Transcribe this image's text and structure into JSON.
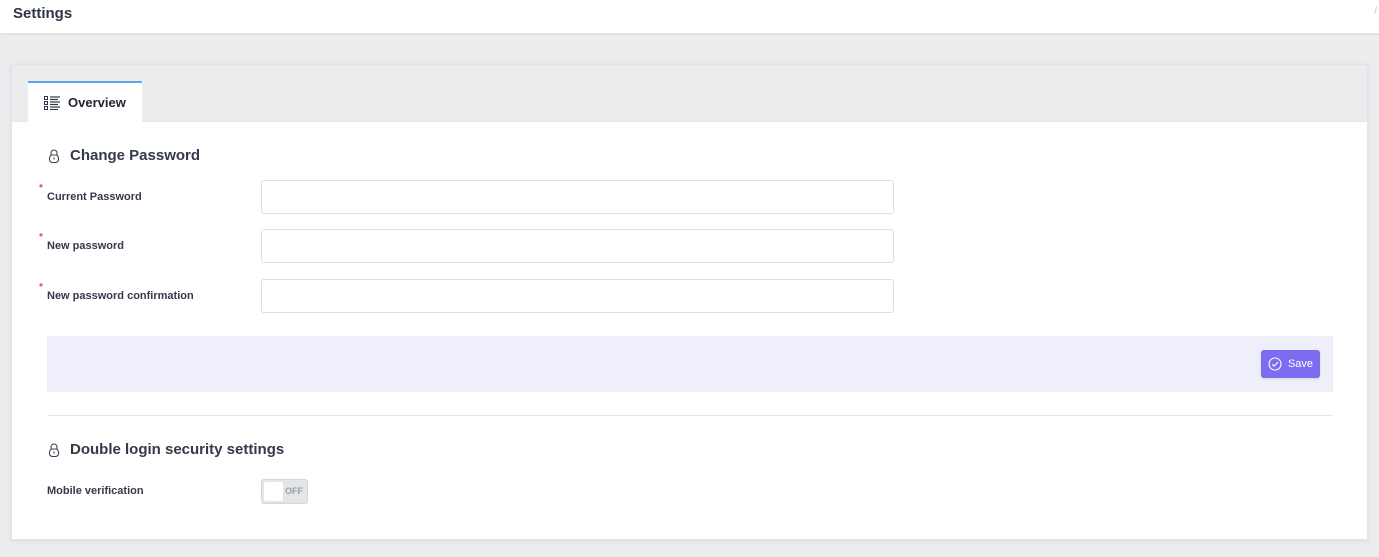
{
  "header": {
    "title": "Settings",
    "breadcrumb_separator": "/"
  },
  "tabs": [
    {
      "label": "Overview",
      "icon": "list-icon",
      "active": true
    }
  ],
  "change_password": {
    "title": "Change Password",
    "icon": "lock-icon",
    "fields": [
      {
        "label": "Current Password",
        "required": true,
        "value": "",
        "placeholder": ""
      },
      {
        "label": "New password",
        "required": true,
        "value": "",
        "placeholder": ""
      },
      {
        "label": "New password confirmation",
        "required": true,
        "value": "",
        "placeholder": ""
      }
    ],
    "required_marker": "*",
    "save_label": "Save",
    "save_icon": "check-circle-icon"
  },
  "double_login": {
    "title": "Double login security settings",
    "icon": "lock-icon",
    "mobile_verification": {
      "label": "Mobile verification",
      "state_text": "OFF",
      "enabled": false
    }
  },
  "colors": {
    "accent": "#7b6cf0",
    "tab_border": "#5ea5f0",
    "required": "#e5484d",
    "action_bar": "#efeffc"
  }
}
